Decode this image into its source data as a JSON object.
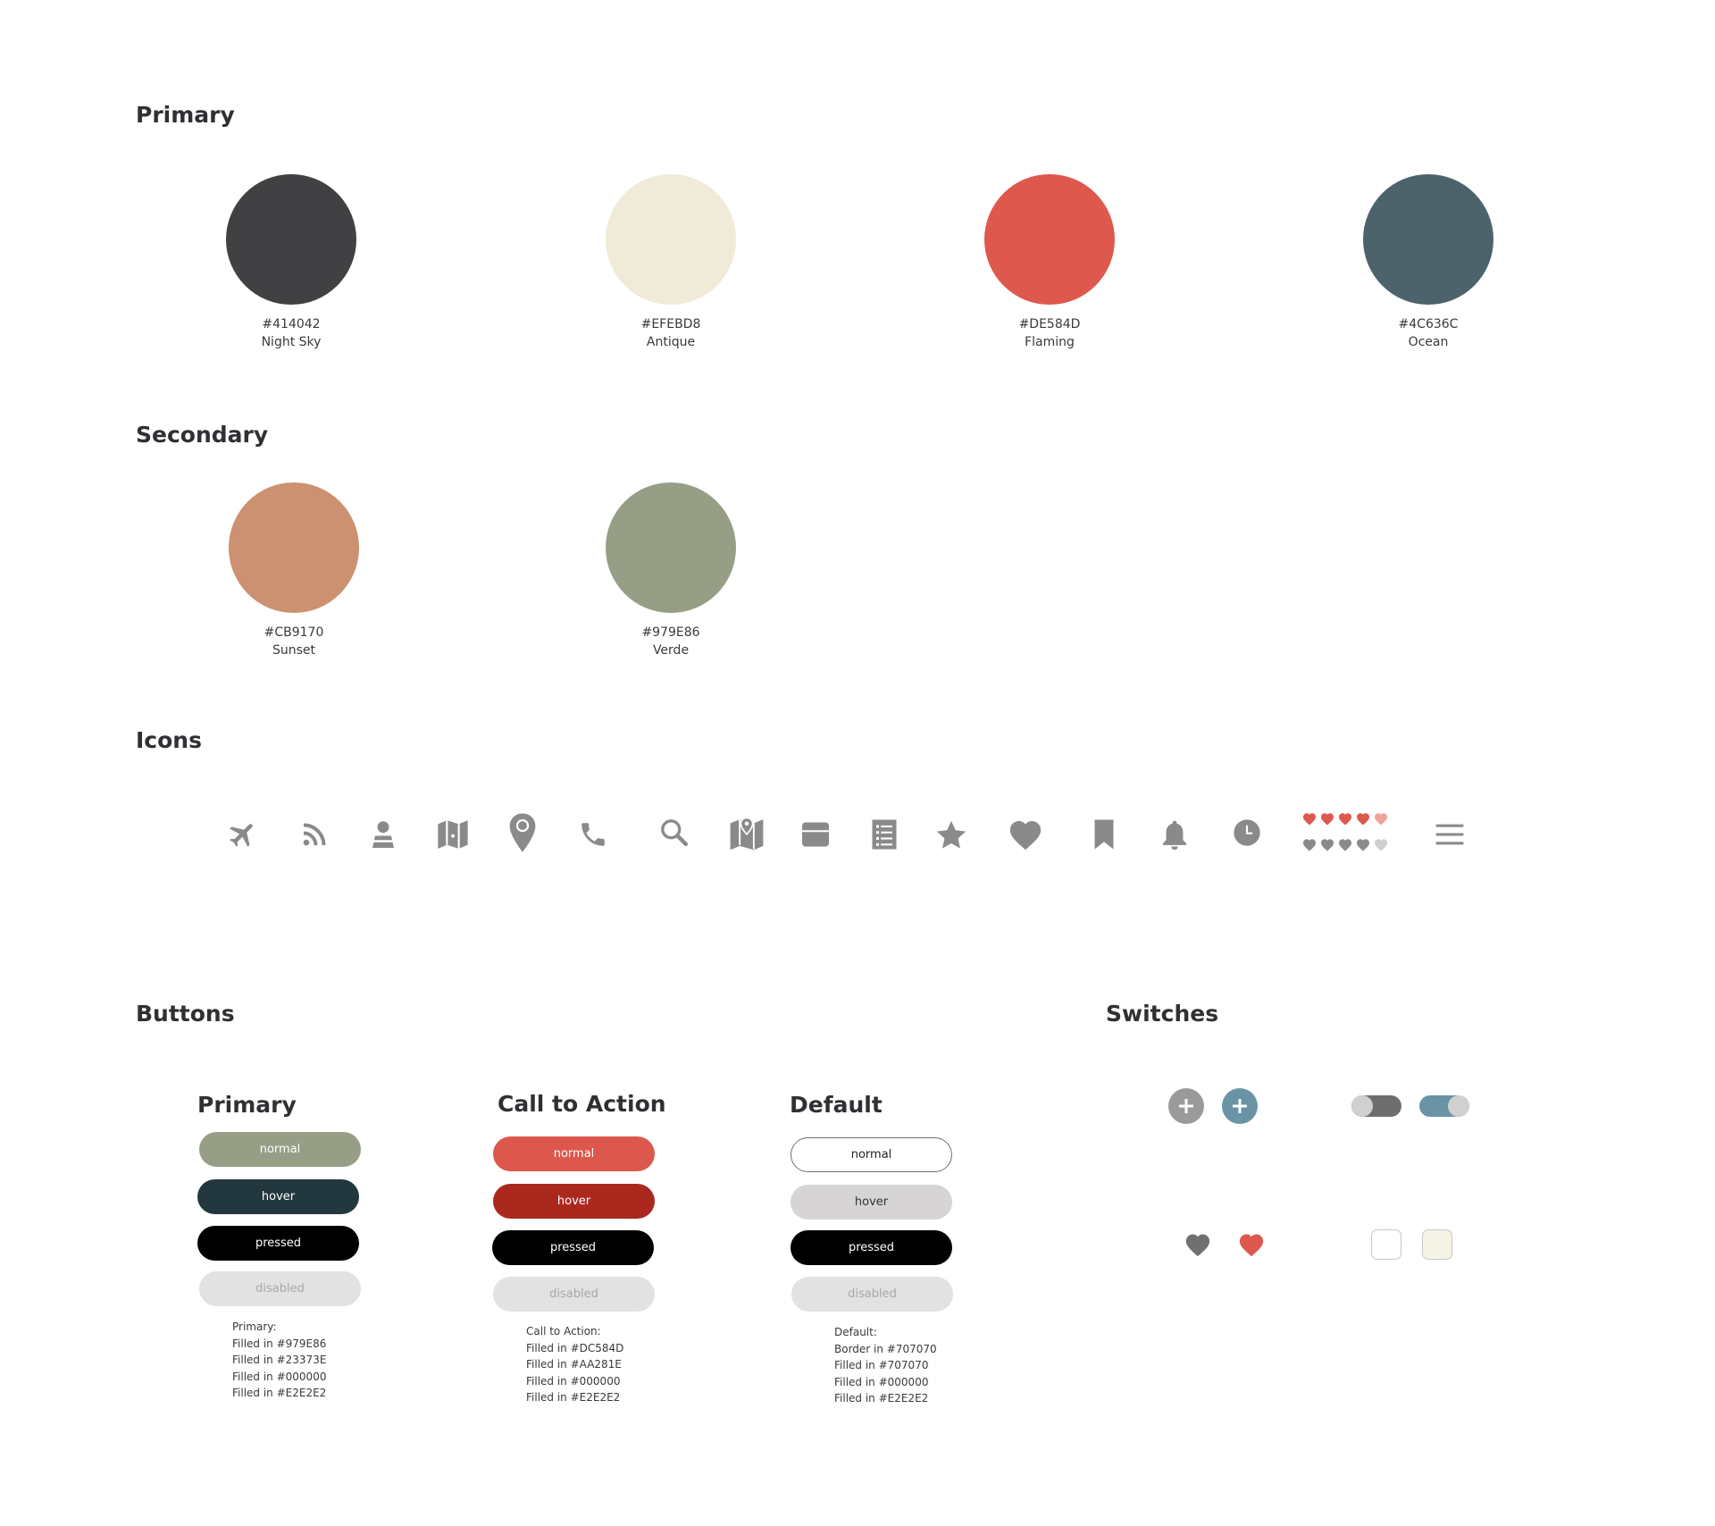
{
  "sections": {
    "primary": "Primary",
    "secondary": "Secondary",
    "icons": "Icons",
    "buttons": "Buttons",
    "switches": "Switches"
  },
  "primary_colors": [
    {
      "hex": "#414042",
      "name": "Night Sky"
    },
    {
      "hex": "#EFEBD8",
      "name": "Antique"
    },
    {
      "hex": "#DE584D",
      "name": "Flaming"
    },
    {
      "hex": "#4C636C",
      "name": "Ocean"
    }
  ],
  "secondary_colors": [
    {
      "hex": "#CB9170",
      "name": "Sunset"
    },
    {
      "hex": "#979E86",
      "name": "Verde"
    }
  ],
  "icons": [
    "airplane-icon",
    "rss-icon",
    "person-icon",
    "map-icon",
    "location-pin-icon",
    "phone-icon",
    "search-icon",
    "map-pin-icon",
    "card-icon",
    "list-icon",
    "star-icon",
    "heart-icon",
    "bookmark-icon",
    "bell-icon",
    "clock-icon",
    "heart-rating-icon",
    "menu-icon"
  ],
  "icon_color": "#8a8a8a",
  "button_groups": {
    "primary": {
      "title": "Primary",
      "normal": "normal",
      "hover": "hover",
      "pressed": "pressed",
      "disabled": "disabled",
      "note_title": "Primary:",
      "notes": [
        "Filled in #979E86",
        "Filled in #23373E",
        "Filled in #000000",
        "Filled in #E2E2E2"
      ]
    },
    "cta": {
      "title": "Call to Action",
      "normal": "normal",
      "hover": "hover",
      "pressed": "pressed",
      "disabled": "disabled",
      "note_title": "Call to Action:",
      "notes": [
        "Filled in #DC584D",
        "Filled in #AA281E",
        "Filled in #000000",
        "Filled in #E2E2E2"
      ]
    },
    "default": {
      "title": "Default",
      "normal": "normal",
      "hover": "hover",
      "pressed": "pressed",
      "disabled": "disabled",
      "note_title": "Default:",
      "notes": [
        "Border in #707070",
        "Filled in #707070",
        "Filled in #000000",
        "Filled in #E2E2E2"
      ]
    }
  },
  "colors": {
    "primary_normal": "#979E86",
    "primary_hover": "#23373E",
    "pressed": "#000000",
    "disabled": "#E2E2E2",
    "cta_normal": "#DC584D",
    "cta_hover": "#AA281E",
    "default_border": "#707070",
    "default_hover_fill": "#D6D4D4",
    "plus_gray": "#9a9a9a",
    "plus_blue": "#6a94a6",
    "heart_gray": "#707070",
    "heart_red": "#DE584D",
    "checkbox_checked": "#F5F3E6"
  }
}
